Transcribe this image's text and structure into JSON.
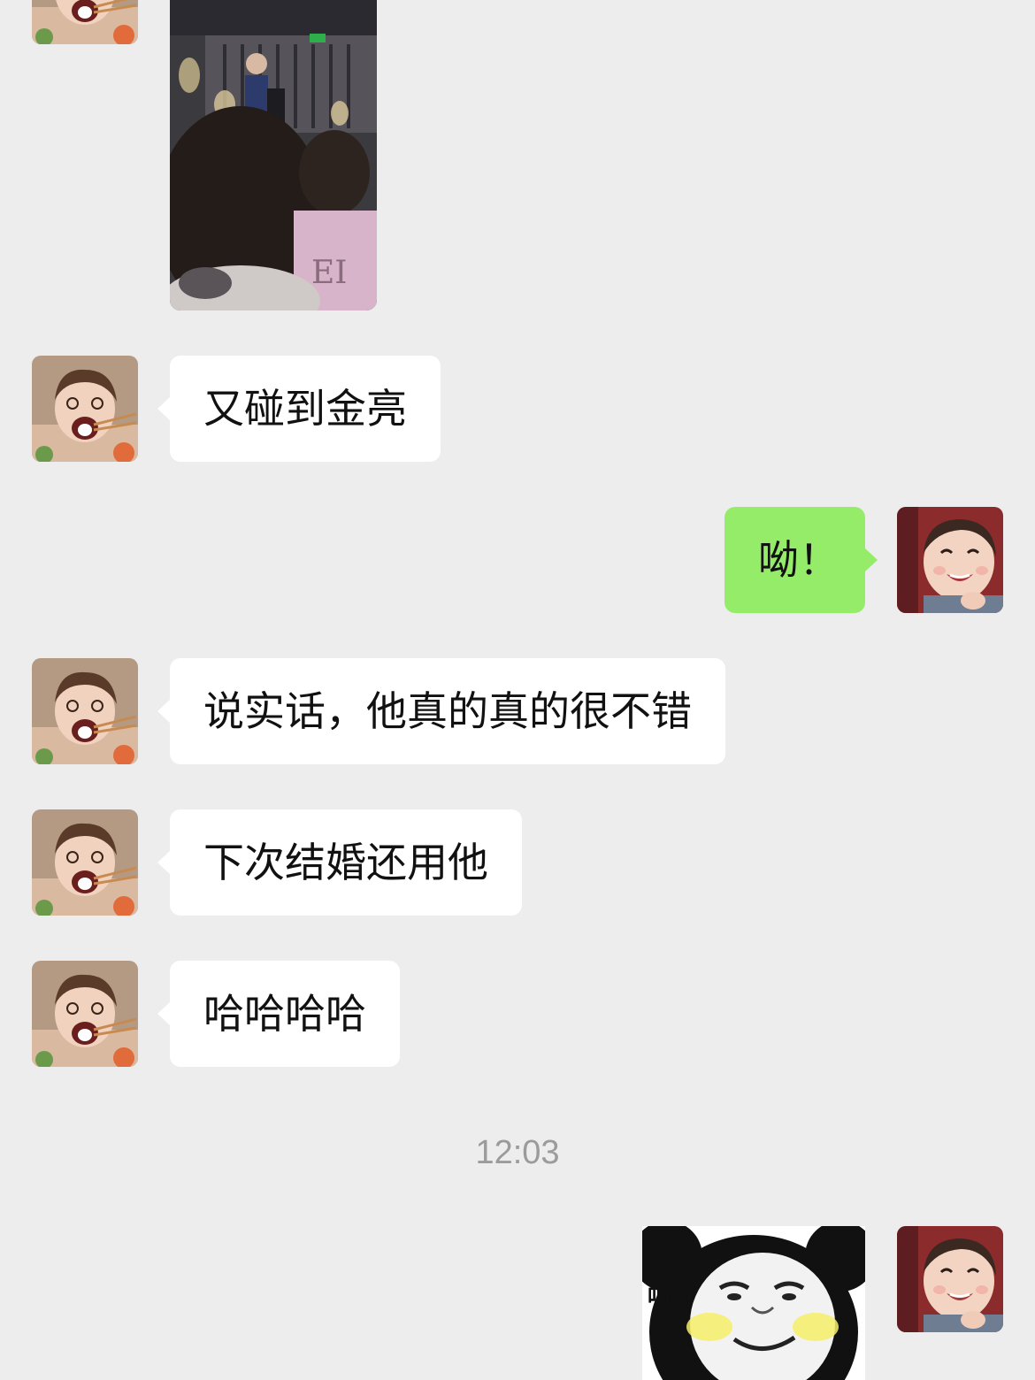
{
  "messages": {
    "m1": {
      "sender": "friend",
      "type": "image"
    },
    "m2": {
      "sender": "friend",
      "text": "又碰到金亮"
    },
    "m3": {
      "sender": "me",
      "text": "呦！"
    },
    "m4": {
      "sender": "friend",
      "text": "说实话，他真的真的很不错"
    },
    "m5": {
      "sender": "friend",
      "text": "下次结婚还用他"
    },
    "m6": {
      "sender": "friend",
      "text": "哈哈哈哈"
    },
    "m7": {
      "sender": "me",
      "type": "sticker",
      "caption": "听听"
    }
  },
  "timestamp": "12:03",
  "colors": {
    "background": "#ededed",
    "incoming_bubble": "#ffffff",
    "outgoing_bubble": "#95ec69",
    "timestamp_text": "#9b9b9b"
  },
  "icons": {
    "friend_avatar": "cartoon-girl-avatar",
    "my_avatar": "smiling-child-avatar",
    "sticker": "panda-meme-sticker"
  }
}
